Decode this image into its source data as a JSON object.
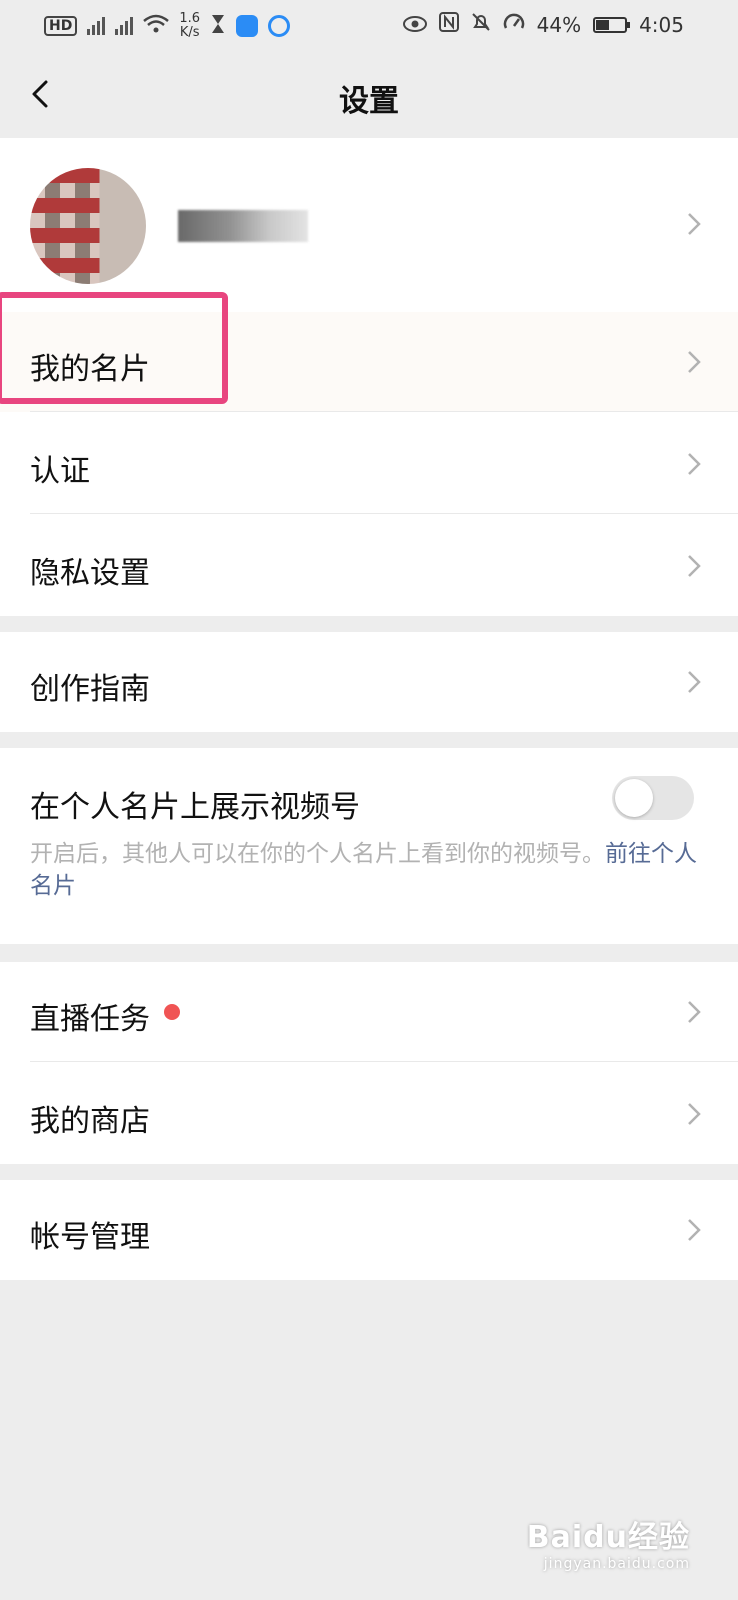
{
  "status_bar": {
    "hd": "HD",
    "net_speed": "1.6",
    "net_unit": "K/s",
    "battery": "44%",
    "time": "4:05"
  },
  "nav": {
    "title": "设置"
  },
  "menu": {
    "my_card": "我的名片",
    "verify": "认证",
    "privacy": "隐私设置",
    "creator_guide": "创作指南"
  },
  "toggle_section": {
    "label": "在个人名片上展示视频号",
    "description": "开启后，其他人可以在你的个人名片上看到你的视频号。",
    "link": "前往个人名片",
    "enabled": false
  },
  "menu2": {
    "live_tasks": "直播任务",
    "my_store": "我的商店",
    "account": "帐号管理"
  },
  "watermark": {
    "brand": "Baidu经验",
    "url": "jingyan.baidu.com"
  },
  "colors": {
    "background": "#ededed",
    "highlight": "#e8457f",
    "link": "#576b95",
    "dot": "#f05454"
  }
}
